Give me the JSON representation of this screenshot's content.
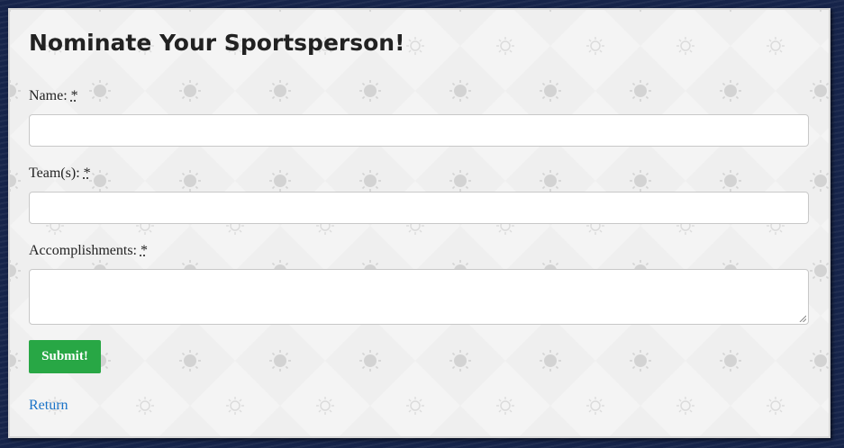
{
  "form": {
    "title": "Nominate Your Sportsperson!",
    "required_marker": "*",
    "fields": [
      {
        "label": "Name:",
        "value": "",
        "type": "text"
      },
      {
        "label": "Team(s):",
        "value": "",
        "type": "text"
      },
      {
        "label": "Accomplishments:",
        "value": "",
        "type": "textarea"
      }
    ],
    "submit_label": "Submit!",
    "return_label": "Return"
  },
  "colors": {
    "page_background": "#16244a",
    "card_background": "#efefef",
    "submit_button": "#28a745",
    "link": "#1a73c8"
  },
  "icons": [
    "sun-icon"
  ]
}
